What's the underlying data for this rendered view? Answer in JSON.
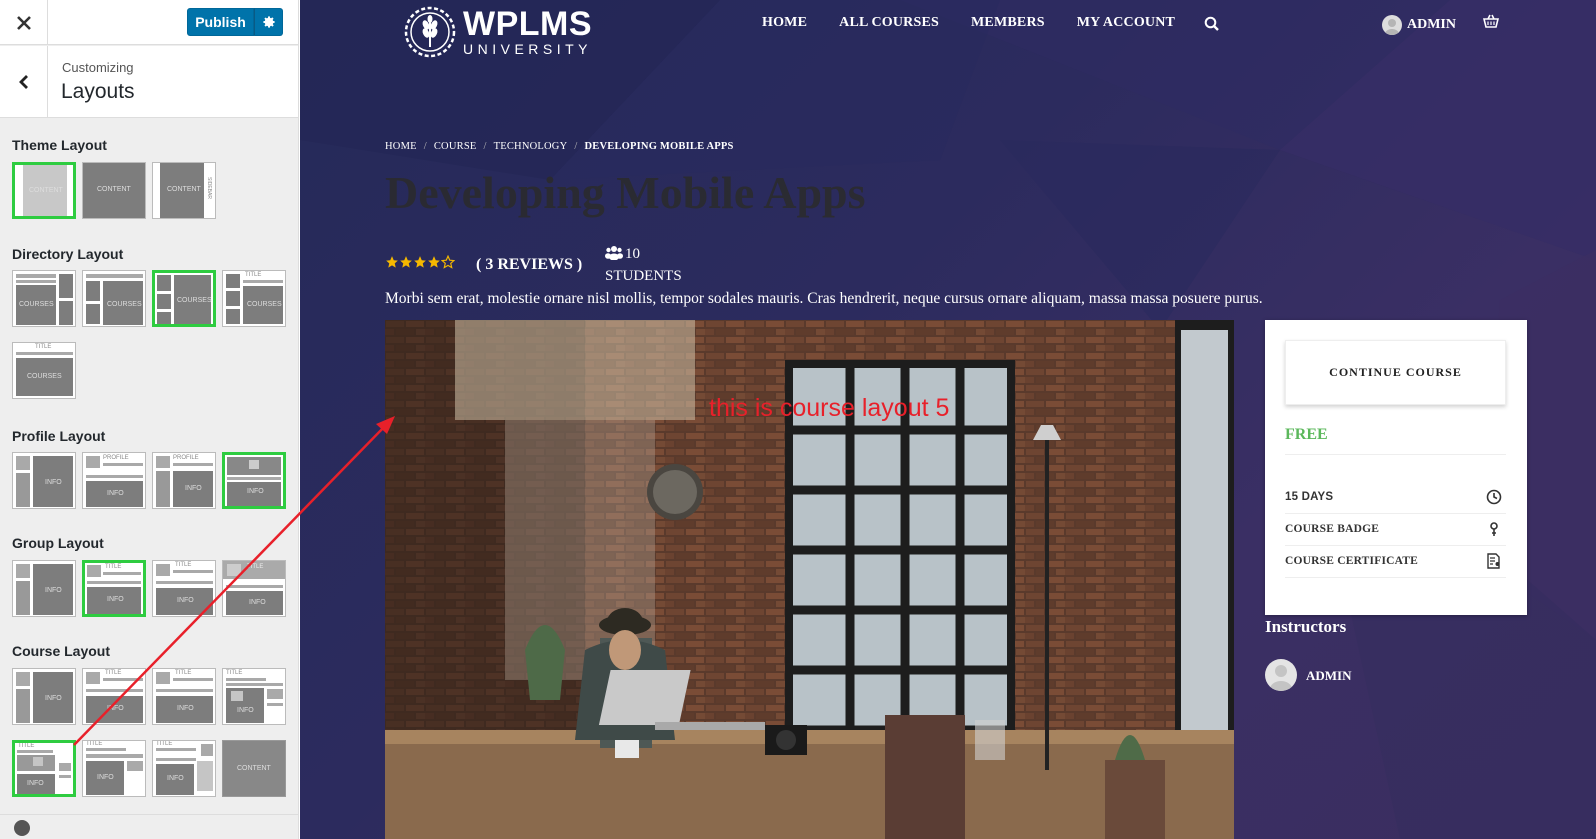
{
  "customizer": {
    "close_icon": "close-icon",
    "publish_label": "Publish",
    "publish_gear_icon": "gear-icon",
    "back_icon": "chevron-left-icon",
    "breadcrumb": "Customizing",
    "title": "Layouts",
    "sections": {
      "theme": "Theme Layout",
      "directory": "Directory Layout",
      "profile": "Profile Layout",
      "group": "Group Layout",
      "course": "Course Layout"
    },
    "thumb_text": {
      "content": "CONTENT",
      "courses": "COURSES",
      "title": "TITLE",
      "info": "INFO",
      "profile": "PROFILE",
      "sidebar": "SIDEBAR"
    }
  },
  "site": {
    "logo_main": "WPLMS",
    "logo_sub": "UNIVERSITY",
    "nav": [
      "HOME",
      "ALL COURSES",
      "MEMBERS",
      "MY ACCOUNT"
    ],
    "user_name": "ADMIN",
    "breadcrumb": [
      "HOME",
      "COURSE",
      "TECHNOLOGY",
      "DEVELOPING MOBILE APPS"
    ],
    "breadcrumb_sep": "/",
    "course_title": "Developing Mobile Apps",
    "rating": 4,
    "reviews": "( 3 REVIEWS )",
    "students_count": "10",
    "students_label": "STUDENTS",
    "description": "Morbi sem erat, molestie ornare nisl mollis, tempor sodales mauris. Cras hendrerit, neque cursus ornare aliquam, massa massa posuere purus."
  },
  "card": {
    "button": "CONTINUE COURSE",
    "price": "FREE",
    "details": [
      {
        "label": "15 DAYS",
        "icon": "clock-icon"
      },
      {
        "label": "COURSE BADGE",
        "icon": "badge-icon"
      },
      {
        "label": "COURSE CERTIFICATE",
        "icon": "certificate-icon"
      }
    ]
  },
  "instructors": {
    "title": "Instructors",
    "name": "ADMIN"
  },
  "annotation": "this is course layout 5",
  "colors": {
    "accent": "#0073aa",
    "selected_border": "#2ecc40",
    "price": "#5cb85c",
    "annotation": "#e8202a"
  }
}
